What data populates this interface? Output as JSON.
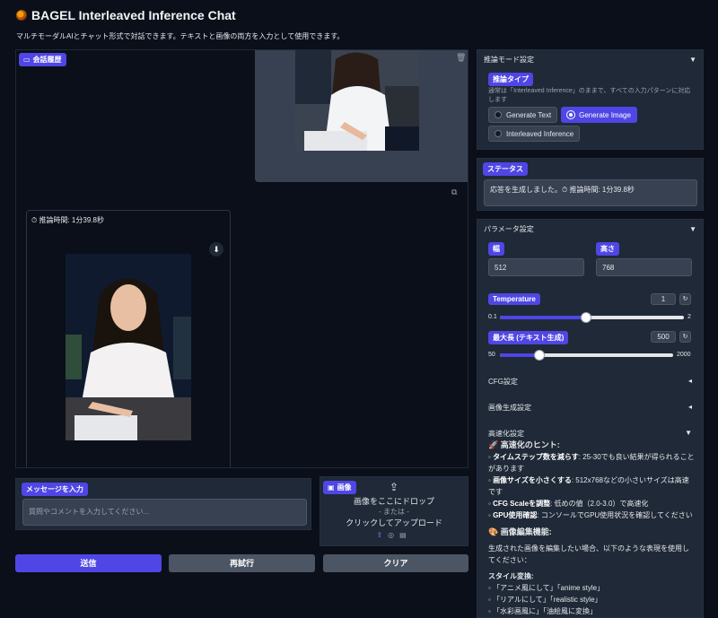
{
  "app": {
    "title": "BAGEL Interleaved Inference Chat",
    "subtitle": "マルチモーダルAIとチャット形式で対話できます。テキストと画像の両方を入力として使用できます。"
  },
  "chat": {
    "label": "会話履歴",
    "bot_timer": "推論時間: 1分39.8秒"
  },
  "input": {
    "message_label": "メッセージを入力",
    "message_placeholder": "質問やコメントを入力してください...",
    "image_label": "画像",
    "drop_text": "画像をここにドロップ",
    "or_text": "- または -",
    "click_text": "クリックしてアップロード"
  },
  "buttons": {
    "send": "送信",
    "retry": "再試行",
    "clear": "クリア"
  },
  "mode": {
    "section_title": "推論モード設定",
    "type_label": "推論タイプ",
    "type_desc": "通常は「Interleaved Inference」のままで、すべての入力パターンに対応します",
    "options": [
      "Generate Text",
      "Generate Image",
      "Interleaved Inference"
    ],
    "selected": "Generate Image"
  },
  "status": {
    "label": "ステータス",
    "text": "応答を生成しました。⏱ 推論時間: 1分39.8秒"
  },
  "params": {
    "section_title": "パラメータ設定",
    "width_label": "幅",
    "width_value": "512",
    "height_label": "高さ",
    "height_value": "768",
    "temperature": {
      "label": "Temperature",
      "value": "1",
      "min": "0.1",
      "max": "2",
      "fraction": 0.47
    },
    "max_len": {
      "label": "最大長 (テキスト生成)",
      "value": "500",
      "min": "50",
      "max": "2000",
      "fraction": 0.23
    },
    "cfg": "CFG設定",
    "imggen": "画像生成設定",
    "speedup": "高速化設定"
  },
  "tips": {
    "heading": "高速化のヒント:",
    "items": [
      {
        "bold": "タイムステップ数を減らす",
        "text": ": 25-30でも良い結果が得られることがあります"
      },
      {
        "bold": "画像サイズを小さくする",
        "text": ": 512x768などの小さいサイズは高速です"
      },
      {
        "bold": "CFG Scaleを調整",
        "text": ": 低めの値（2.0-3.0）で高速化"
      },
      {
        "bold": "GPU使用確認",
        "text": ": コンソールでGPU使用状況を確認してください"
      }
    ],
    "edit_heading": "画像編集機能:",
    "edit_desc": "生成された画像を編集したい場合、以下のような表現を使用してください：",
    "style_heading": "スタイル変換:",
    "style_items": [
      "「アニメ風にして」「anime style」",
      "「リアルにして」「realistic style」",
      "「水彩画風に」「油絵風に変換」"
    ]
  },
  "colors": {
    "accent": "#4f46e5",
    "panel": "#1f2937",
    "bg": "#0b0f19"
  }
}
